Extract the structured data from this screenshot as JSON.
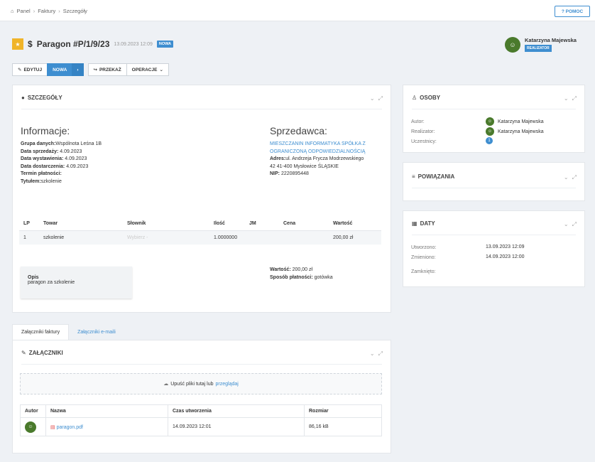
{
  "breadcrumb": {
    "home": "Panel",
    "items": [
      "Faktury",
      "Szczegóły"
    ]
  },
  "help_button": "? POMOC",
  "document": {
    "currency_symbol": "$",
    "title": "Paragon #P/1/9/23",
    "date": "13.09.2023 12:09",
    "status": "NOWA"
  },
  "current_user": {
    "name": "Katarzyna Majewska",
    "role": "REALIZATOR"
  },
  "toolbar": {
    "edit": "EDYTUJ",
    "status": "NOWA",
    "arrow": "›",
    "forward": "PRZEKAŻ",
    "operations": "OPERACJE"
  },
  "details": {
    "title": "SZCZEGÓŁY",
    "info_heading": "Informacje:",
    "info": [
      {
        "label": "Grupa danych:",
        "value": "Wspólnota Leśna 1B"
      },
      {
        "label": "Data sprzedaży:",
        "value": " 4.09.2023"
      },
      {
        "label": "Data wystawienia:",
        "value": " 4.09.2023"
      },
      {
        "label": "Data dostarczenia:",
        "value": " 4.09.2023"
      },
      {
        "label": "Termin płatności:",
        "value": ""
      },
      {
        "label": "Tytułem:",
        "value": "szkolenie"
      }
    ],
    "seller_heading": "Sprzedawca:",
    "seller_name_1": "MIESZCZANIN INFORMATYKA SPÓŁKA Z",
    "seller_name_2": "OGRANICZONĄ ODPOWIEDZIALNOŚCIĄ",
    "seller_address_label": "Adres:",
    "seller_address_1": "ul. Andrzeja Frycza Modrzewskiego",
    "seller_address_2": "42 41-400 Mysłowice ŚLĄSKIE",
    "seller_nip_label": "NIP:",
    "seller_nip": " 2220895448",
    "table": {
      "headers": [
        "LP",
        "Towar",
        "Słownik",
        "Ilość",
        "JM",
        "Cena",
        "Wartość"
      ],
      "row": [
        "1",
        "szkolenie",
        "Wybierz -",
        "1.0000000",
        "",
        "",
        "200,00 zł"
      ]
    },
    "opis_label": "Opis",
    "opis_value": "paragon za szkolenie",
    "total_label": "Wartość:",
    "total_value": " 200,00 zł",
    "payment_label": "Sposób płatności:",
    "payment_value": " gotówka"
  },
  "tabs": [
    "Załączniki faktury",
    "Załączniki e-maili"
  ],
  "attachments": {
    "title": "ZAŁĄCZNIKI",
    "drop_text": "Upuść pliki tutaj lub",
    "drop_link": "przeglądaj",
    "headers": [
      "Autor",
      "Nazwa",
      "Czas utworzenia",
      "Rozmiar"
    ],
    "file": {
      "name": "paragon.pdf",
      "created": "14.09.2023 12:01",
      "size": "86,16 kB"
    }
  },
  "people": {
    "title": "OSOBY",
    "author_label": "Autor:",
    "author": "Katarzyna Majewska",
    "assignee_label": "Realizator:",
    "assignee": "Katarzyna Majewska",
    "participants_label": "Uczestnicy:",
    "participants_count": "1"
  },
  "relations": {
    "title": "POWIĄZANIA"
  },
  "dates": {
    "title": "DATY",
    "created_label": "Utworzono:",
    "created": "13.09.2023 12:09",
    "modified_label": "Zmieniono:",
    "modified": "14.09.2023 12:00",
    "closed_label": "Zamknięto:",
    "closed": ""
  },
  "colors": {
    "accent": "#3e8ed0",
    "bookmark": "#f0b429",
    "pdf": "#e04b4b"
  }
}
